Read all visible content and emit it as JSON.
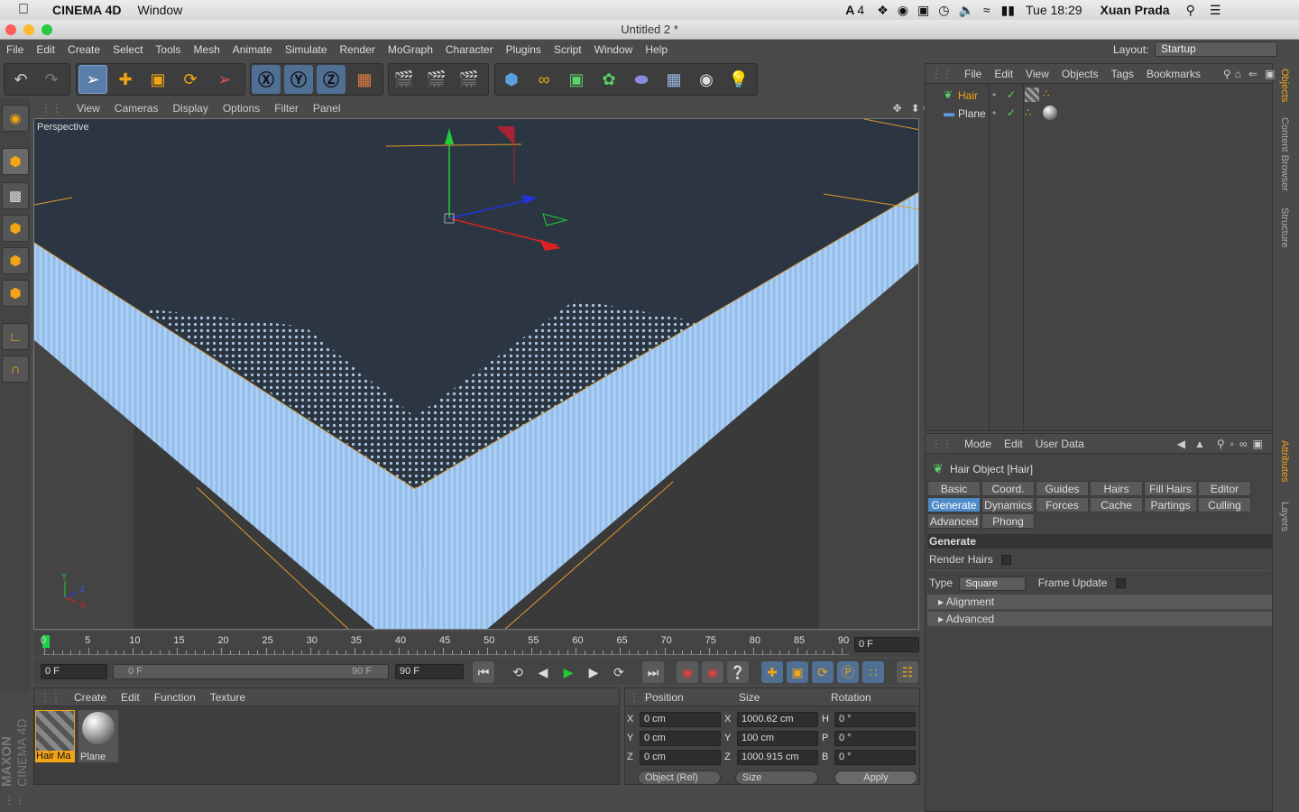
{
  "mac_menubar": {
    "app_name": "CINEMA 4D",
    "menu_window": "Window",
    "adobe_badge": "4",
    "clock": "Tue 18:29",
    "user": "Xuan Prada"
  },
  "window": {
    "title": "Untitled 2 *"
  },
  "main_menu": [
    "File",
    "Edit",
    "Create",
    "Select",
    "Tools",
    "Mesh",
    "Animate",
    "Simulate",
    "Render",
    "MoGraph",
    "Character",
    "Plugins",
    "Script",
    "Window",
    "Help"
  ],
  "layout": {
    "label": "Layout:",
    "value": "Startup"
  },
  "viewport": {
    "menu": [
      "View",
      "Cameras",
      "Display",
      "Options",
      "Filter",
      "Panel"
    ],
    "camera_label": "Perspective",
    "axis_labels": {
      "y": "Y",
      "z": "Z",
      "x": "X"
    }
  },
  "timeline": {
    "ticks": [
      "0",
      "5",
      "10",
      "15",
      "20",
      "25",
      "30",
      "35",
      "40",
      "45",
      "50",
      "55",
      "60",
      "65",
      "70",
      "75",
      "80",
      "85",
      "90"
    ],
    "current_frame": "0 F"
  },
  "transport": {
    "start_field": "0 F",
    "range_start": "0 F",
    "range_end": "90 F",
    "end_field": "90 F"
  },
  "material_manager": {
    "menu": [
      "Create",
      "Edit",
      "Function",
      "Texture"
    ],
    "materials": [
      {
        "name": "Hair Ma"
      },
      {
        "name": "Plane"
      }
    ]
  },
  "coordinates": {
    "headers": {
      "position": "Position",
      "size": "Size",
      "rotation": "Rotation"
    },
    "rows": [
      {
        "axis": "X",
        "pos": "0 cm",
        "size_axis": "X",
        "size": "1000.62 cm",
        "rot_axis": "H",
        "rot": "0 °"
      },
      {
        "axis": "Y",
        "pos": "0 cm",
        "size_axis": "Y",
        "size": "100 cm",
        "rot_axis": "P",
        "rot": "0 °"
      },
      {
        "axis": "Z",
        "pos": "0 cm",
        "size_axis": "Z",
        "size": "1000.915 cm",
        "rot_axis": "B",
        "rot": "0 °"
      }
    ],
    "mode_select": "Object (Rel)",
    "size_select": "Size",
    "apply_label": "Apply"
  },
  "maxon_logo": {
    "line1": "MAXON",
    "line2": "CINEMA 4D"
  },
  "object_manager": {
    "menu": [
      "File",
      "Edit",
      "View",
      "Objects",
      "Tags",
      "Bookmarks"
    ],
    "objects": [
      {
        "name": "Hair",
        "active": true
      },
      {
        "name": "Plane",
        "active": false
      }
    ]
  },
  "attribute_manager": {
    "menu": [
      "Mode",
      "Edit",
      "User Data"
    ],
    "object_title": "Hair Object [Hair]",
    "tabs_row1": [
      "Basic",
      "Coord.",
      "Guides",
      "Hairs",
      "Fill Hairs",
      "Editor"
    ],
    "tabs_row2": [
      "Generate",
      "Dynamics",
      "Forces",
      "Cache",
      "Partings",
      "Culling"
    ],
    "tabs_row3": [
      "Advanced",
      "Phong"
    ],
    "active_tab": "Generate",
    "section": "Generate",
    "render_hairs_label": "Render Hairs",
    "type_label": "Type",
    "type_value": "Square",
    "frame_update_label": "Frame Update",
    "subsections": [
      "Alignment",
      "Advanced"
    ]
  },
  "right_dock_tabs": [
    "Objects",
    "Content Browser",
    "Structure",
    "Attributes",
    "Layers"
  ]
}
